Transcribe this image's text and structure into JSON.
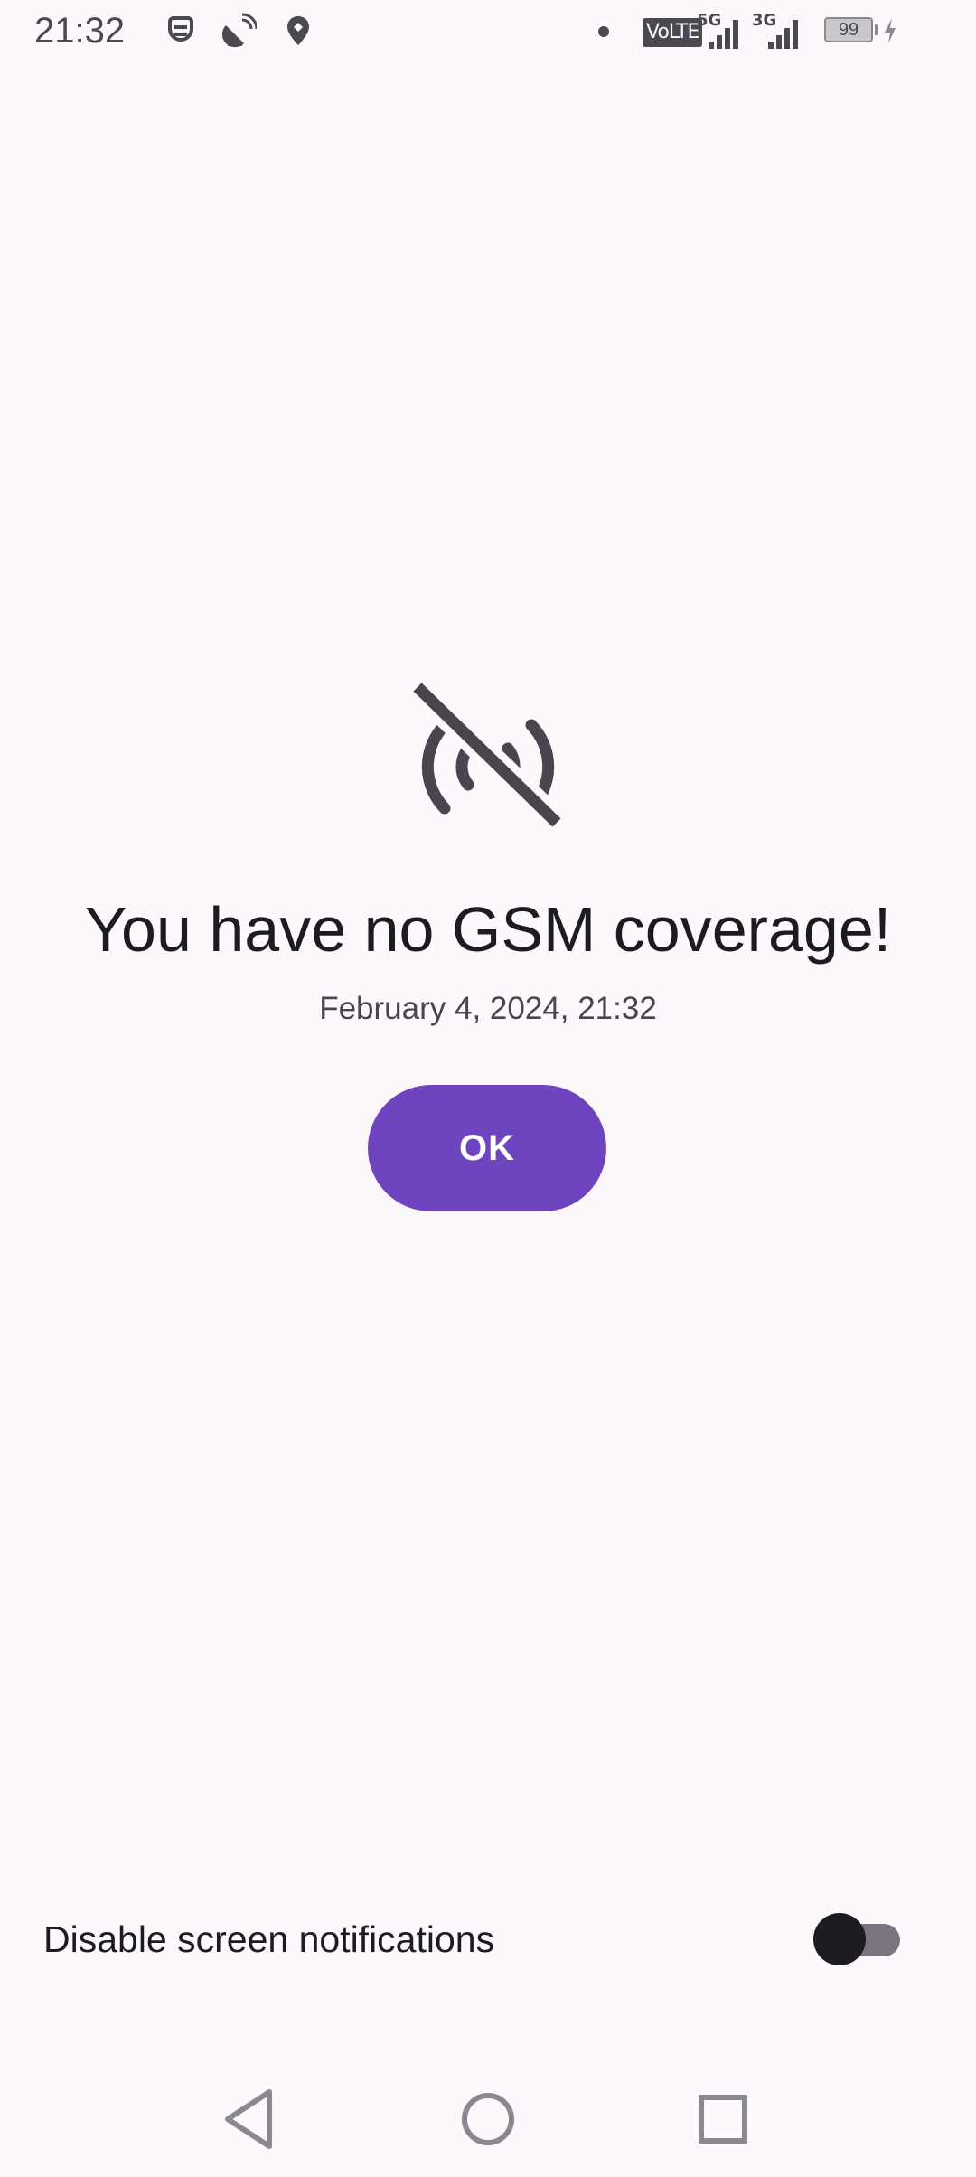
{
  "status_bar": {
    "time": "21:32",
    "volte_label": "VoLTE",
    "net1_label": "5G",
    "net2_label": "3G",
    "battery_level": "99",
    "icons": [
      "sim-icon",
      "satellite-dish-icon",
      "location-pin-icon",
      "notification-dot",
      "volte-icon",
      "signal-5g-icon",
      "signal-3g-icon",
      "battery-icon",
      "charging-bolt-icon"
    ]
  },
  "alert": {
    "icon": "signal-off-icon",
    "title": "You have no GSM coverage!",
    "timestamp": "February 4, 2024, 21:32",
    "ok_label": "OK"
  },
  "settings": {
    "disable_notifications_label": "Disable screen notifications",
    "disable_notifications_enabled": false
  },
  "colors": {
    "background": "#fdf8fc",
    "accent": "#6f45bf",
    "icon": "#49454f",
    "text": "#1c1b1f"
  },
  "nav_bar": {
    "buttons": [
      "back-icon",
      "home-icon",
      "recents-icon"
    ]
  }
}
